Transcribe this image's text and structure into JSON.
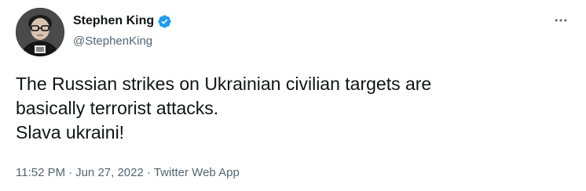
{
  "tweet": {
    "author": {
      "display_name": "Stephen King",
      "handle": "@StephenKing",
      "verified": true,
      "verified_color": "#1d9bf0"
    },
    "more_icon": "more-horizontal-icon",
    "text": "The Russian strikes on Ukrainian civilian targets are\nbasically terrorist attacks.\nSlava ukraini!",
    "time": "11:52 PM",
    "separator": "·",
    "date": "Jun 27, 2022",
    "source": "Twitter Web App"
  }
}
